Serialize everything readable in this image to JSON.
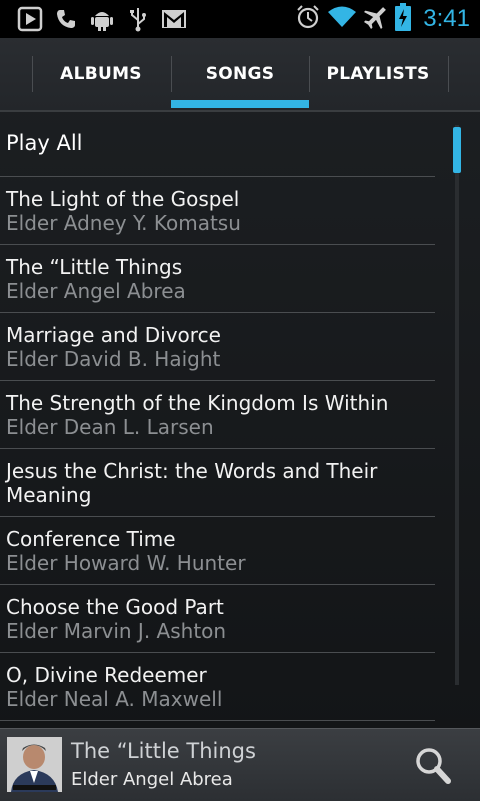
{
  "status_bar": {
    "time": "3:41",
    "icons": [
      "play-store-icon",
      "voicemail-icon",
      "android-debug-icon",
      "usb-icon",
      "gmail-icon",
      "alarm-icon",
      "wifi-icon",
      "airplane-mode-icon",
      "battery-charging-icon"
    ]
  },
  "tabs": [
    {
      "label": "ALBUMS"
    },
    {
      "label": "SONGS",
      "selected": true
    },
    {
      "label": "PLAYLISTS"
    }
  ],
  "list": {
    "play_all": "Play All",
    "songs": [
      {
        "title": "The Light of the Gospel",
        "artist": "Elder Adney Y. Komatsu"
      },
      {
        "title": "The “Little Things",
        "artist": "Elder Angel Abrea"
      },
      {
        "title": "Marriage and Divorce",
        "artist": "Elder David B. Haight"
      },
      {
        "title": "The Strength of the Kingdom Is Within",
        "artist": "Elder Dean L. Larsen"
      },
      {
        "title": "Jesus the Christ: the Words and Their Meaning",
        "artist": ""
      },
      {
        "title": "Conference Time",
        "artist": "Elder Howard W. Hunter"
      },
      {
        "title": "Choose the Good Part",
        "artist": "Elder Marvin J. Ashton"
      },
      {
        "title": "O, Divine Redeemer",
        "artist": "Elder Neal A. Maxwell"
      }
    ]
  },
  "now_playing": {
    "title": "The “Little Things",
    "artist": "Elder Angel Abrea"
  },
  "colors": {
    "accent": "#33b5e5",
    "background": "#16181b",
    "secondary_text": "#8c8f92"
  }
}
